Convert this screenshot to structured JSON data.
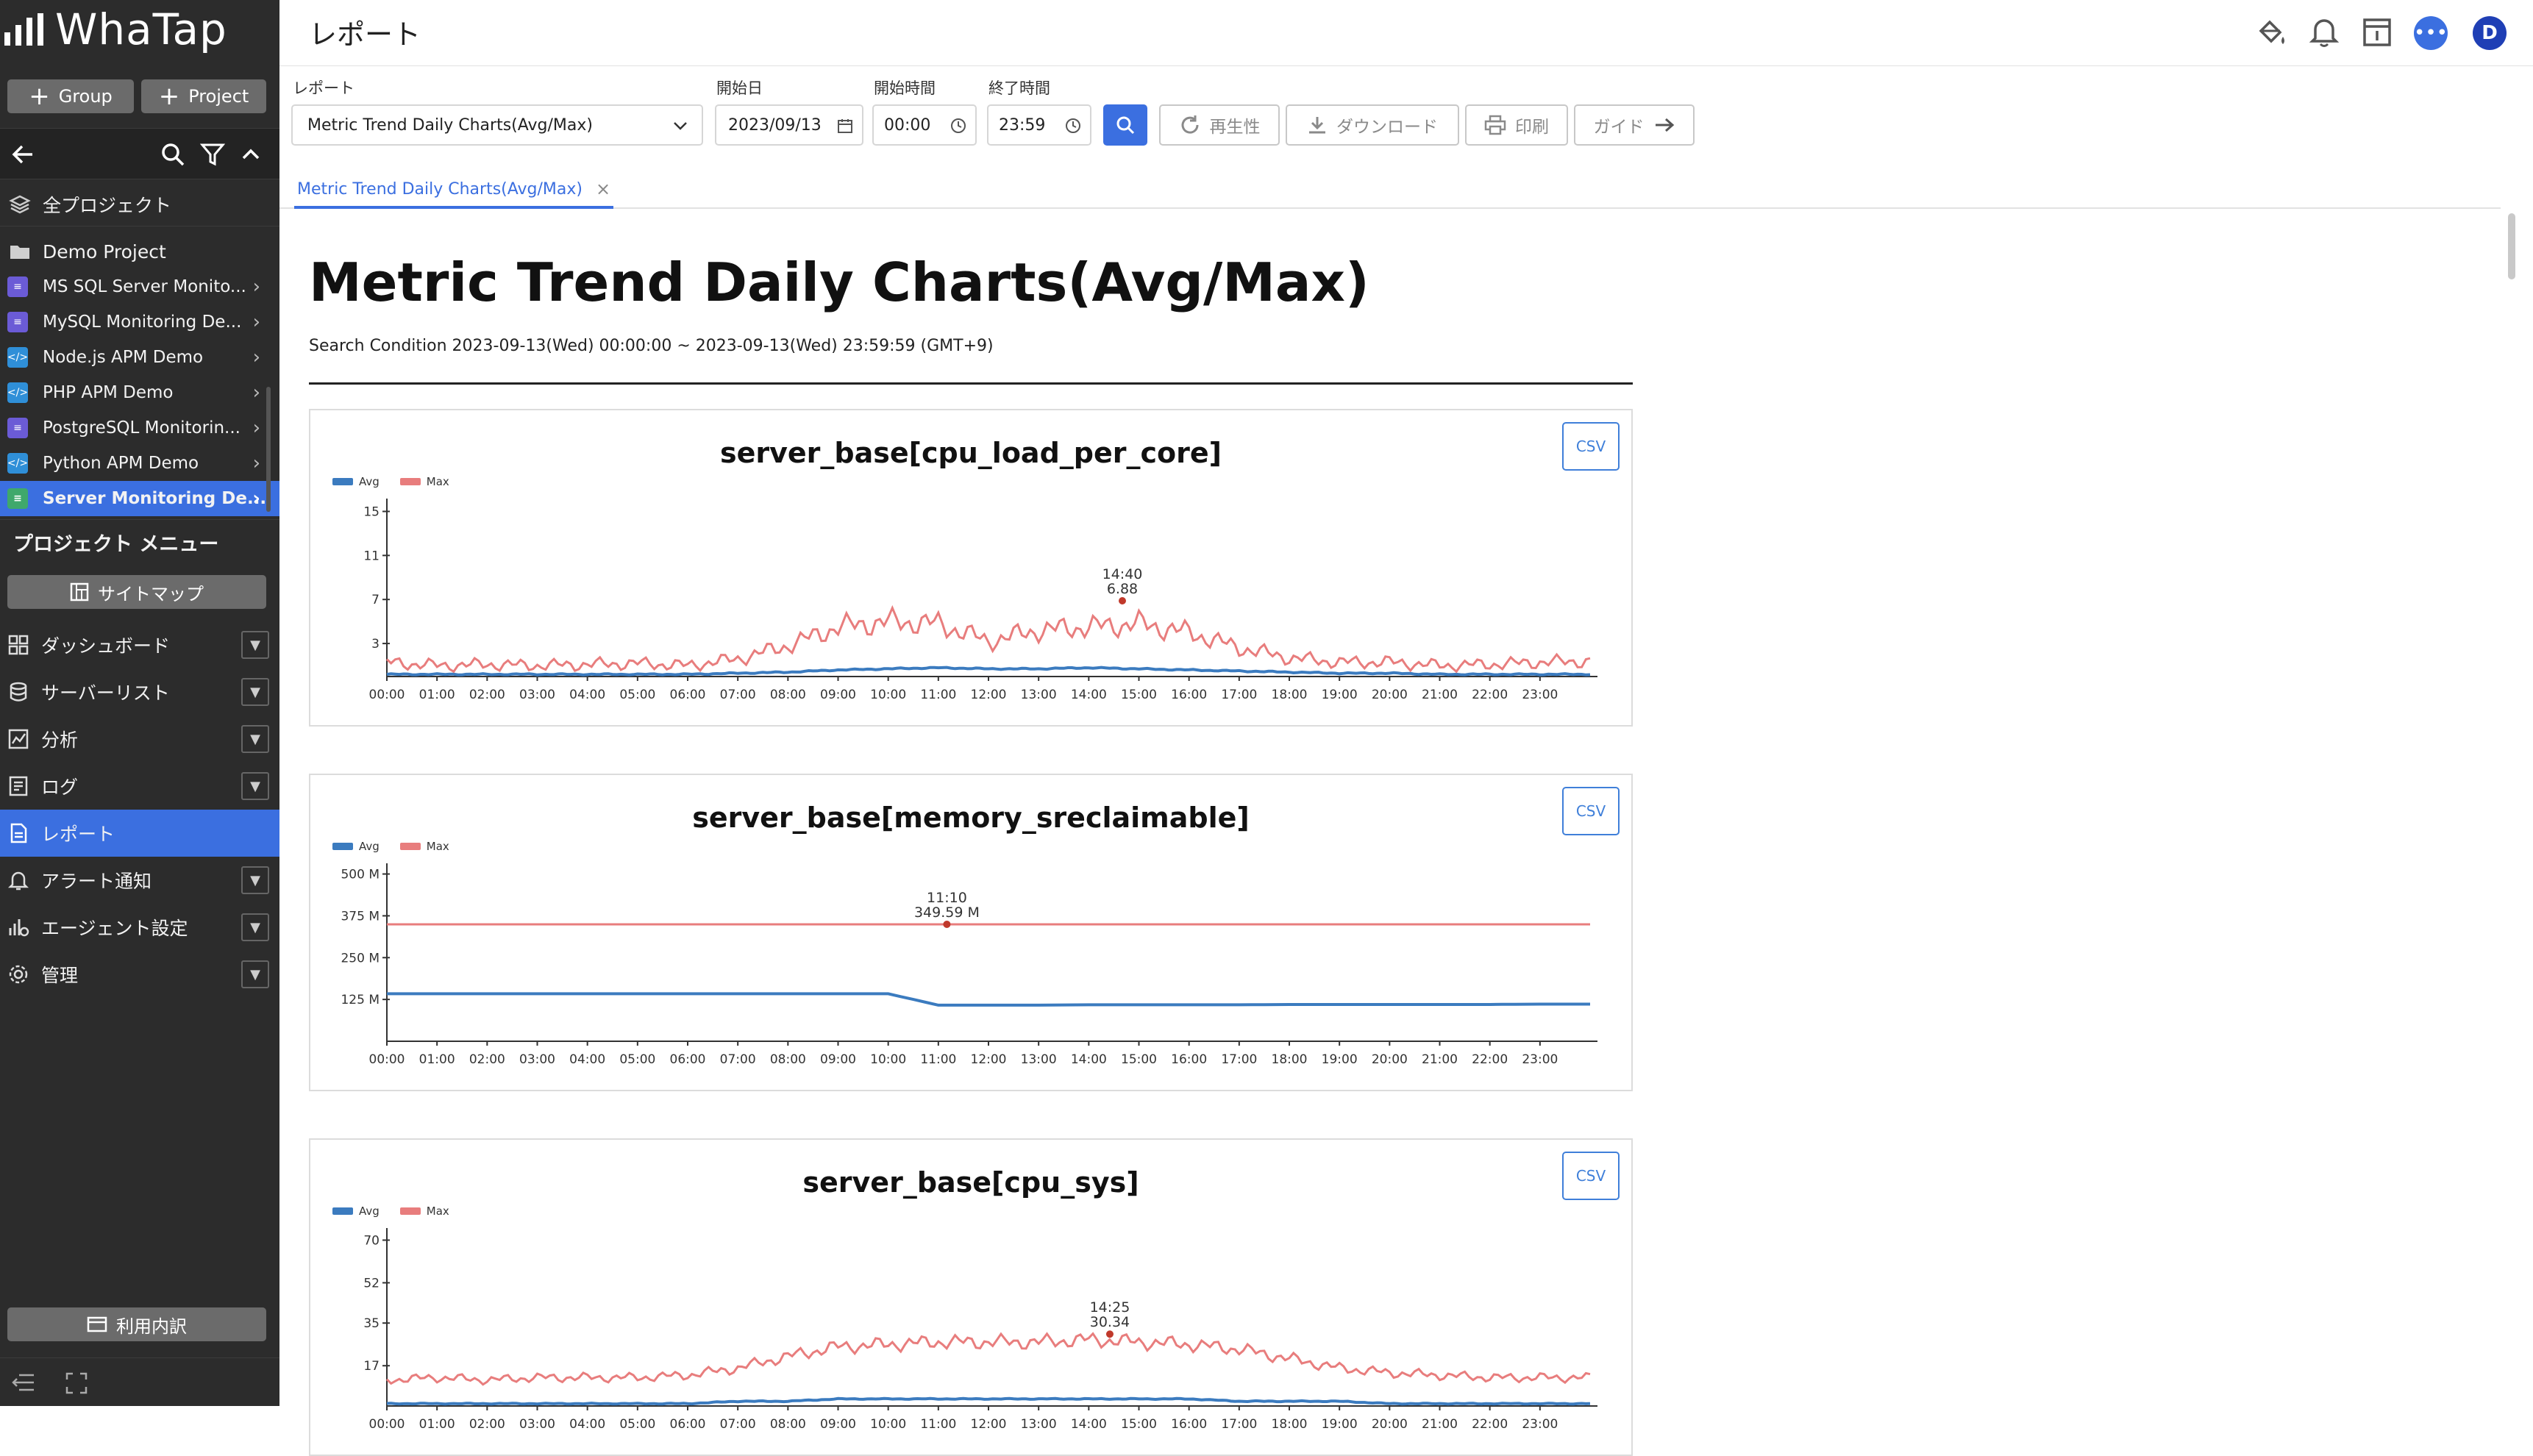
{
  "app": {
    "logo_text": "WhaTap"
  },
  "sidebar": {
    "group_button": "Group",
    "project_button": "Project",
    "all_projects": "全プロジェクト",
    "current_folder": "Demo Project",
    "projects": [
      {
        "label": "MS SQL Server Monito...",
        "icon": "database-icon",
        "color": "#6b5bd6"
      },
      {
        "label": "MySQL Monitoring De...",
        "icon": "database-icon",
        "color": "#6b5bd6"
      },
      {
        "label": "Node.js APM Demo",
        "icon": "code-icon",
        "color": "#2f8fd8"
      },
      {
        "label": "PHP APM Demo",
        "icon": "code-icon",
        "color": "#2f8fd8"
      },
      {
        "label": "PostgreSQL Monitorin...",
        "icon": "database-icon",
        "color": "#6b5bd6"
      },
      {
        "label": "Python APM Demo",
        "icon": "code-icon",
        "color": "#2f8fd8"
      },
      {
        "label": "Server Monitoring De...",
        "icon": "server-icon",
        "color": "#3fa86b",
        "active": true
      }
    ],
    "project_menu_title": "プロジェクト メニュー",
    "sitemap_button": "サイトマップ",
    "menu": [
      {
        "label": "ダッシュボード",
        "icon": "grid-icon"
      },
      {
        "label": "サーバーリスト",
        "icon": "database-icon"
      },
      {
        "label": "分析",
        "icon": "chart-icon"
      },
      {
        "label": "ログ",
        "icon": "log-icon"
      },
      {
        "label": "レポート",
        "icon": "report-icon",
        "active": true
      },
      {
        "label": "アラート通知",
        "icon": "bell-icon"
      },
      {
        "label": "エージェント設定",
        "icon": "agent-settings-icon"
      },
      {
        "label": "管理",
        "icon": "gear-icon"
      }
    ],
    "usage_button": "利用内訳"
  },
  "header": {
    "title": "レポート",
    "avatar_letter": "D"
  },
  "controls": {
    "report_label": "レポート",
    "report_value": "Metric Trend Daily Charts(Avg/Max)",
    "start_date_label": "開始日",
    "start_date": "2023/09/13",
    "start_time_label": "開始時間",
    "start_time": "00:00",
    "end_time_label": "終了時間",
    "end_time": "23:59",
    "replay_button": "再生性",
    "download_button": "ダウンロード",
    "print_button": "印刷",
    "guide_button": "ガイド"
  },
  "tab": {
    "label": "Metric Trend Daily Charts(Avg/Max)"
  },
  "report": {
    "title": "Metric Trend Daily Charts(Avg/Max)",
    "condition": "Search Condition 2023-09-13(Wed) 00:00:00 ~ 2023-09-13(Wed) 23:59:59 (GMT+9)",
    "csv_label": "CSV",
    "legend_avg": "Avg",
    "legend_max": "Max"
  },
  "colors": {
    "accent": "#3b6fe0",
    "avg": "#3b7bbf",
    "max": "#e87d7d",
    "sidebar_bg": "#2c2c2c"
  },
  "chart_data": [
    {
      "type": "line",
      "title": "server_base[cpu_load_per_core]",
      "x_ticks": [
        "00:00",
        "01:00",
        "02:00",
        "03:00",
        "04:00",
        "05:00",
        "06:00",
        "07:00",
        "08:00",
        "09:00",
        "10:00",
        "11:00",
        "12:00",
        "13:00",
        "14:00",
        "15:00",
        "16:00",
        "17:00",
        "18:00",
        "19:00",
        "20:00",
        "21:00",
        "22:00",
        "23:00"
      ],
      "y_ticks": [
        "3",
        "7",
        "11",
        "15"
      ],
      "ylim": [
        0,
        15.5
      ],
      "peak": {
        "time": "14:40",
        "value": "6.88",
        "x": 14.67,
        "y": 6.88
      },
      "series": [
        {
          "name": "Avg",
          "values": [
            0.2,
            0.2,
            0.2,
            0.2,
            0.2,
            0.2,
            0.2,
            0.3,
            0.4,
            0.6,
            0.7,
            0.8,
            0.7,
            0.7,
            0.8,
            0.7,
            0.6,
            0.5,
            0.4,
            0.3,
            0.3,
            0.2,
            0.2,
            0.2,
            0.2
          ]
        },
        {
          "name": "Max",
          "values": [
            1.3,
            1.0,
            1.1,
            1.0,
            1.1,
            1.2,
            1.0,
            1.6,
            2.8,
            4.5,
            5.0,
            4.8,
            3.2,
            4.2,
            4.5,
            4.8,
            4.0,
            2.6,
            1.7,
            1.3,
            1.3,
            1.0,
            1.1,
            1.3,
            1.4
          ]
        }
      ]
    },
    {
      "type": "line",
      "title": "server_base[memory_sreclaimable]",
      "x_ticks": [
        "00:00",
        "01:00",
        "02:00",
        "03:00",
        "04:00",
        "05:00",
        "06:00",
        "07:00",
        "08:00",
        "09:00",
        "10:00",
        "11:00",
        "12:00",
        "13:00",
        "14:00",
        "15:00",
        "16:00",
        "17:00",
        "18:00",
        "19:00",
        "20:00",
        "21:00",
        "22:00",
        "23:00"
      ],
      "y_ticks": [
        "125 M",
        "250 M",
        "375 M",
        "500 M"
      ],
      "ylim": [
        0,
        510
      ],
      "peak": {
        "time": "11:10",
        "value": "349.59 M",
        "x": 11.17,
        "y": 349.59
      },
      "series": [
        {
          "name": "Avg",
          "values": [
            142,
            142,
            142,
            142,
            142,
            142,
            142,
            142,
            142,
            142,
            142,
            108,
            108,
            108,
            109,
            109,
            109,
            109,
            110,
            110,
            110,
            110,
            110,
            111,
            111
          ]
        },
        {
          "name": "Max",
          "values": [
            349.6,
            349.6,
            349.6,
            349.6,
            349.6,
            349.6,
            349.6,
            349.6,
            349.6,
            349.6,
            349.6,
            349.6,
            349.6,
            349.6,
            349.6,
            349.6,
            349.6,
            349.6,
            349.6,
            349.6,
            349.6,
            349.6,
            349.6,
            349.6,
            349.6
          ]
        }
      ]
    },
    {
      "type": "line",
      "title": "server_base[cpu_sys]",
      "x_ticks": [
        "00:00",
        "01:00",
        "02:00",
        "03:00",
        "04:00",
        "05:00",
        "06:00",
        "07:00",
        "08:00",
        "09:00",
        "10:00",
        "11:00",
        "12:00",
        "13:00",
        "14:00",
        "15:00",
        "16:00",
        "17:00",
        "18:00",
        "19:00",
        "20:00",
        "21:00",
        "22:00",
        "23:00"
      ],
      "y_ticks": [
        "17",
        "35",
        "52",
        "70"
      ],
      "ylim": [
        0,
        72
      ],
      "peak": {
        "time": "14:25",
        "value": "30.34",
        "x": 14.42,
        "y": 30.34
      },
      "series": [
        {
          "name": "Avg",
          "values": [
            1,
            1,
            1,
            1,
            1,
            1,
            1,
            2,
            2,
            3,
            3,
            3,
            3,
            3,
            3,
            3,
            3,
            2,
            2,
            2,
            1,
            1,
            1,
            1,
            1
          ]
        },
        {
          "name": "Max",
          "values": [
            11,
            12,
            11,
            12,
            12,
            12,
            13,
            16,
            21,
            25,
            26,
            27,
            27,
            27,
            28,
            27,
            26,
            24,
            20,
            16,
            14,
            13,
            12,
            12,
            12
          ]
        }
      ]
    }
  ]
}
